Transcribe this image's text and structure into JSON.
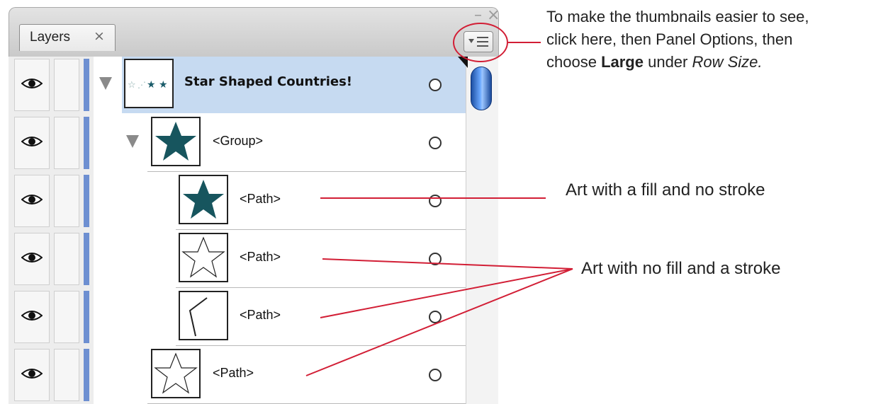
{
  "panel": {
    "tab_label": "Layers",
    "tab_close_glyph": "×",
    "minimize_glyph": "–",
    "close_glyph": "×",
    "menu_icon": "panel-menu-icon",
    "accent_color": "#6d8fd1",
    "selection_color": "#c6daf1",
    "layers": [
      {
        "label": "Star Shaped Countries!",
        "kind": "layer",
        "selected": true,
        "expanded": true
      },
      {
        "label": "<Group>",
        "kind": "group",
        "expanded": true
      },
      {
        "label": "<Path>",
        "kind": "path-filled-star"
      },
      {
        "label": "<Path>",
        "kind": "path-outline-star"
      },
      {
        "label": "<Path>",
        "kind": "path-open-stroke"
      },
      {
        "label": "<Path>",
        "kind": "path-outline-star"
      }
    ]
  },
  "annotations": {
    "top_line1": "To make the thumbnails easier to see,",
    "top_line2": "click here, then Panel Options, then",
    "top_line3_pre": "choose ",
    "top_line3_bold": "Large",
    "top_line3_mid": " under ",
    "top_line3_italic": "Row Size.",
    "fill_note": "Art with a fill and no stroke",
    "stroke_note": "Art with no fill and a stroke",
    "callout_color": "#d21e35"
  }
}
